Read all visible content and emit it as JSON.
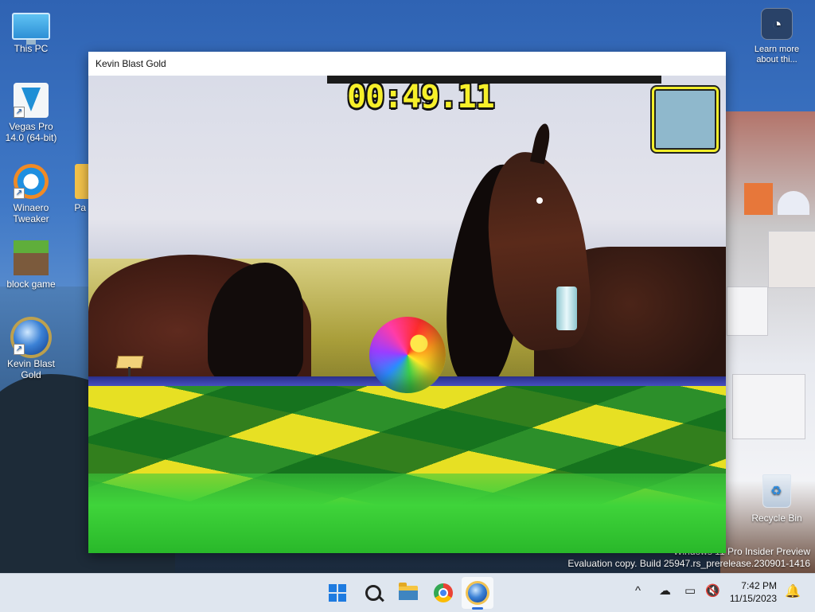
{
  "desktop": {
    "icons": [
      {
        "label": "This PC"
      },
      {
        "label": "Vegas Pro\n14.0 (64-bit)"
      },
      {
        "label": "Winaero\nTweaker"
      },
      {
        "label": "block game"
      },
      {
        "label": "Kevin Blast\nGold"
      }
    ],
    "partial_icon_label": "Pa",
    "learn_more": "Learn more\nabout thi...",
    "recycle_bin": "Recycle Bin",
    "watermark_line1": "Windows 11 Pro Insider Preview",
    "watermark_line2": "Evaluation copy. Build 25947.rs_prerelease.230901-1416"
  },
  "window": {
    "title": "Kevin Blast Gold",
    "game": {
      "timer": "00:49.11"
    }
  },
  "taskbar": {
    "time": "7:42 PM",
    "date": "11/15/2023",
    "tray_chevron": "^"
  },
  "icons": {
    "start": "windows-logo-icon",
    "search": "search-icon",
    "explorer": "folder-icon",
    "browser": "chrome-icon",
    "game": "kevin-blast-gold-icon",
    "network": "network-icon",
    "volume": "volume-muted-icon",
    "notifications": "bell-icon"
  },
  "colors": {
    "timer": "#f7f02a",
    "accent": "#1e7be0",
    "taskbar": "#dfe6ef"
  }
}
